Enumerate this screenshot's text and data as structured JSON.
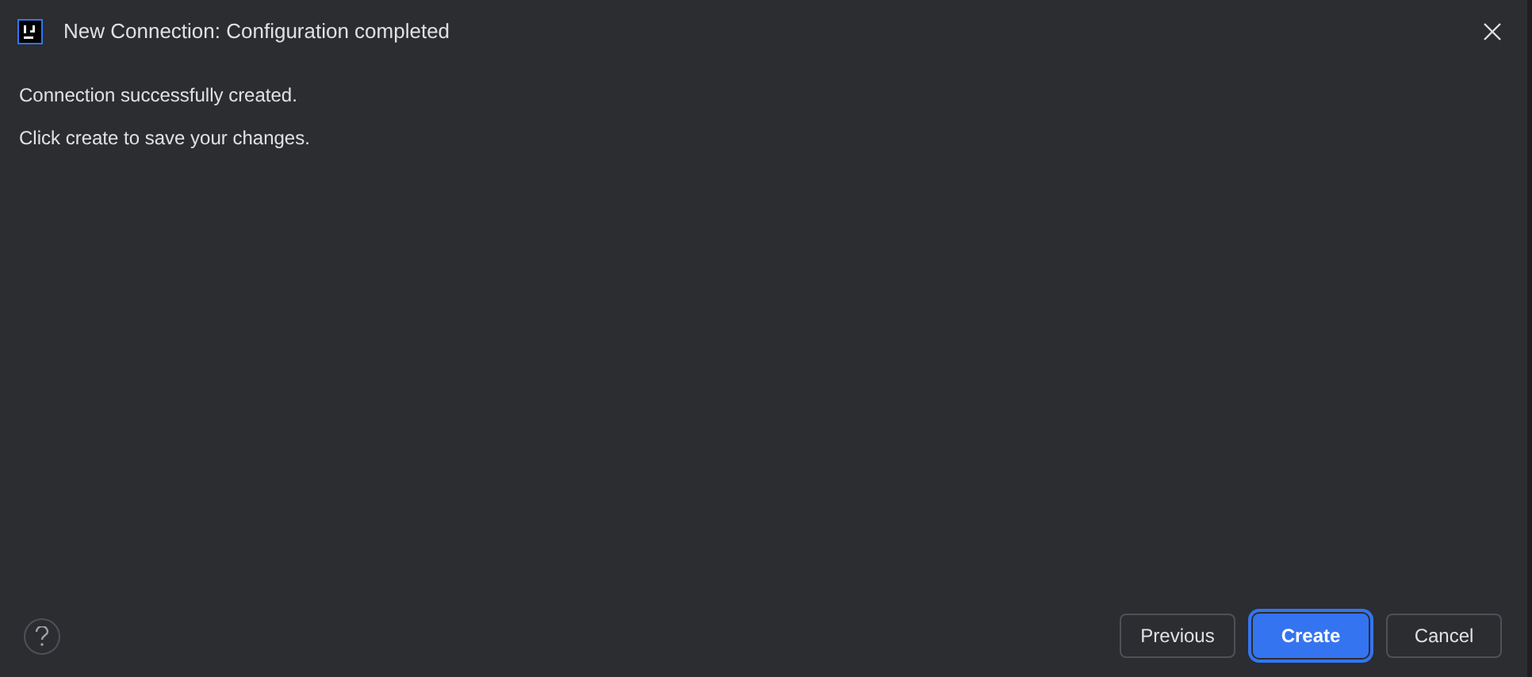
{
  "window": {
    "title": "New Connection: Configuration completed"
  },
  "messages": [
    "Connection successfully created.",
    "Click create to save your changes."
  ],
  "buttons": [
    {
      "label": "Previous",
      "kind": "secondary"
    },
    {
      "label": "Create",
      "kind": "primary"
    },
    {
      "label": "Cancel",
      "kind": "secondary"
    }
  ]
}
